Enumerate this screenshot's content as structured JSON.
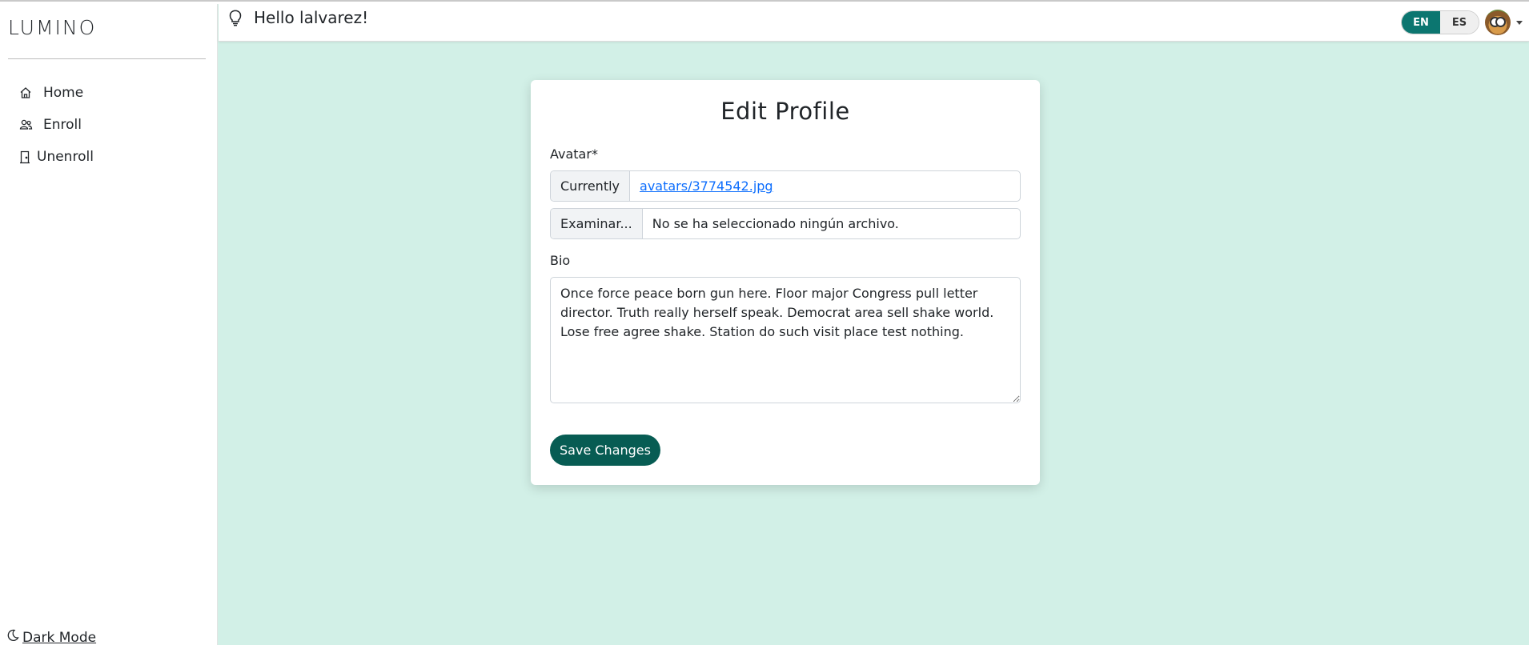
{
  "app": {
    "brand": "LUMINO"
  },
  "sidebar": {
    "items": [
      {
        "label": "Home",
        "icon": "home-icon"
      },
      {
        "label": "Enroll",
        "icon": "users-icon"
      },
      {
        "label": "Unenroll",
        "icon": "door-icon"
      }
    ],
    "dark_mode_label": " Dark Mode"
  },
  "topbar": {
    "greeting": "Hello lalvarez!",
    "languages": [
      "EN",
      "ES"
    ],
    "selected_language": "EN"
  },
  "form": {
    "title": "Edit Profile",
    "avatar_label": "Avatar*",
    "currently_label": "Currently",
    "current_file": "avatars/3774542.jpg",
    "browse_label": "Examinar...",
    "no_file_text": "No se ha seleccionado ningún archivo.",
    "bio_label": "Bio",
    "bio_value": "Once force peace born gun here. Floor major Congress pull letter director. Truth really herself speak. Democrat area sell shake world. Lose free agree shake. Station do such visit place test nothing.",
    "save_label": "Save Changes"
  },
  "colors": {
    "background": "#d2f0e7",
    "accent": "#0c7670",
    "button": "#075c53",
    "link": "#0d6efd"
  }
}
